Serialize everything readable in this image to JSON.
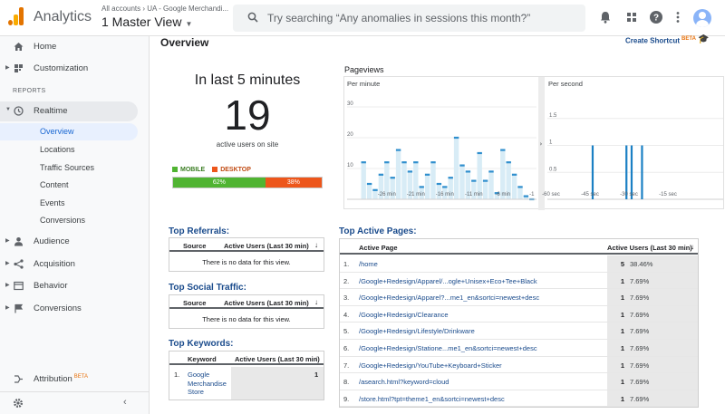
{
  "app": {
    "name": "Analytics",
    "account_path": "All accounts › UA - Google Merchandi...",
    "view": "1 Master View"
  },
  "search": {
    "placeholder": "Try searching “Any anomalies in sessions this month?”"
  },
  "sidebar": {
    "reports_label": "REPORTS",
    "items": [
      {
        "label": "Home",
        "icon": "home-icon"
      },
      {
        "label": "Customization",
        "icon": "grid-icon"
      },
      {
        "label": "Realtime",
        "icon": "clock-icon"
      },
      {
        "label": "Audience",
        "icon": "person-icon"
      },
      {
        "label": "Acquisition",
        "icon": "acquisition-icon"
      },
      {
        "label": "Behavior",
        "icon": "behavior-icon"
      },
      {
        "label": "Conversions",
        "icon": "flag-icon"
      }
    ],
    "realtime_sub": [
      "Overview",
      "Locations",
      "Traffic Sources",
      "Content",
      "Events",
      "Conversions"
    ],
    "attribution": {
      "label": "Attribution",
      "badge": "BETA"
    }
  },
  "main": {
    "title": "Overview",
    "shortcut": {
      "label": "Create Shortcut",
      "badge": "BETA"
    },
    "summary": {
      "heading": "In last 5 minutes",
      "count": "19",
      "count_label": "active users on site",
      "mobile_label": "MOBILE",
      "desktop_label": "DESKTOP",
      "mobile_pct": "62%",
      "desktop_pct": "38%",
      "mobile_share": 0.62,
      "colors": {
        "mobile": "#50b432",
        "desktop": "#ed561b"
      }
    },
    "pageviews": {
      "title": "Pageviews",
      "per_minute_label": "Per minute",
      "per_second_label": "Per second"
    },
    "referrals": {
      "title": "Top Referrals:",
      "columns": [
        "Source",
        "Active Users (Last 30 min)"
      ],
      "empty": "There is no data for this view."
    },
    "social": {
      "title": "Top Social Traffic:",
      "columns": [
        "Source",
        "Active Users (Last 30 min)"
      ],
      "empty": "There is no data for this view."
    },
    "keywords": {
      "title": "Top Keywords:",
      "columns": [
        "Keyword",
        "Active Users (Last 30 min)"
      ],
      "rows": [
        {
          "n": "1.",
          "keyword": "Google Merchandise Store",
          "value": "1"
        }
      ]
    },
    "active_pages": {
      "title": "Top Active Pages:",
      "columns": [
        "Active Page",
        "Active Users (Last 30 min)"
      ],
      "rows": [
        {
          "n": "1.",
          "page": "/home",
          "value": "5",
          "pct": "38.46%"
        },
        {
          "n": "2.",
          "page": "/Google+Redesign/Apparel/...ogle+Unisex+Eco+Tee+Black",
          "value": "1",
          "pct": "7.69%"
        },
        {
          "n": "3.",
          "page": "/Google+Redesign/Apparel?...me1_en&sortci=newest+desc",
          "value": "1",
          "pct": "7.69%"
        },
        {
          "n": "4.",
          "page": "/Google+Redesign/Clearance",
          "value": "1",
          "pct": "7.69%"
        },
        {
          "n": "5.",
          "page": "/Google+Redesign/Lifestyle/Drinkware",
          "value": "1",
          "pct": "7.69%"
        },
        {
          "n": "6.",
          "page": "/Google+Redesign/Statione...me1_en&sortci=newest+desc",
          "value": "1",
          "pct": "7.69%"
        },
        {
          "n": "7.",
          "page": "/Google+Redesign/YouTube+Keyboard+Sticker",
          "value": "1",
          "pct": "7.69%"
        },
        {
          "n": "8.",
          "page": "/asearch.html?keyword=cloud",
          "value": "1",
          "pct": "7.69%"
        },
        {
          "n": "9.",
          "page": "/store.html?tpt=theme1_en&sortci=newest+desc",
          "value": "1",
          "pct": "7.69%"
        }
      ]
    }
  },
  "chart_data": [
    {
      "type": "bar",
      "title": "Per minute",
      "ylim": [
        0,
        35
      ],
      "yticks": [
        10,
        20,
        30
      ],
      "xticks": [
        "-26 min",
        "-21 min",
        "-16 min",
        "-11 min",
        "-6 min",
        "-1"
      ],
      "x": [
        -30,
        -29,
        -28,
        -27,
        -26,
        -25,
        -24,
        -23,
        -22,
        -21,
        -20,
        -19,
        -18,
        -17,
        -16,
        -15,
        -14,
        -13,
        -12,
        -11,
        -10,
        -9,
        -8,
        -7,
        -6,
        -5,
        -4,
        -3,
        -2,
        -1
      ],
      "values": [
        12,
        5,
        3,
        8,
        12,
        7,
        16,
        12,
        9,
        12,
        4,
        8,
        12,
        5,
        4,
        7,
        20,
        11,
        9,
        6,
        15,
        6,
        9,
        2,
        16,
        12,
        8,
        4,
        1,
        0
      ]
    },
    {
      "type": "bar",
      "title": "Per second",
      "ylim": [
        0,
        2
      ],
      "yticks": [
        "0.5",
        "1",
        "1.5"
      ],
      "xticks": [
        "-60 sec",
        "-45 sec",
        "-30 sec",
        "-15 sec"
      ],
      "x": [
        -44,
        -31,
        -29,
        -25
      ],
      "values": [
        1,
        1,
        1,
        1
      ]
    }
  ]
}
